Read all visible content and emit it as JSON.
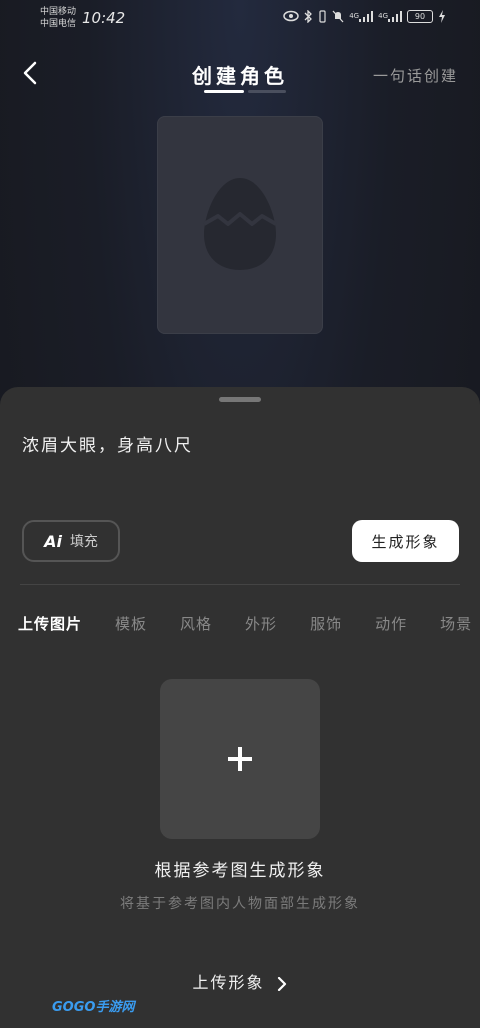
{
  "status_bar": {
    "carrier_1": "中国移动",
    "carrier_2": "中国电信",
    "time": "10:42",
    "sig1": "4G",
    "sig2": "4G",
    "battery": "90"
  },
  "header": {
    "title": "创建角色",
    "right_action": "一句话创建"
  },
  "prompt_text": "浓眉大眼，身高八尺",
  "buttons": {
    "ai_label": "Ai",
    "ai_fill": "填充",
    "generate": "生成形象"
  },
  "tabs": [
    {
      "label": "上传图片"
    },
    {
      "label": "模板"
    },
    {
      "label": "风格"
    },
    {
      "label": "外形"
    },
    {
      "label": "服饰"
    },
    {
      "label": "动作"
    },
    {
      "label": "场景"
    }
  ],
  "upload": {
    "title": "根据参考图生成形象",
    "subtitle": "将基于参考图内人物面部生成形象",
    "link": "上传形象"
  },
  "watermark": "GOGO手游网",
  "colors": {
    "sheet_bg": "#313131",
    "accent": "#ffffff"
  }
}
